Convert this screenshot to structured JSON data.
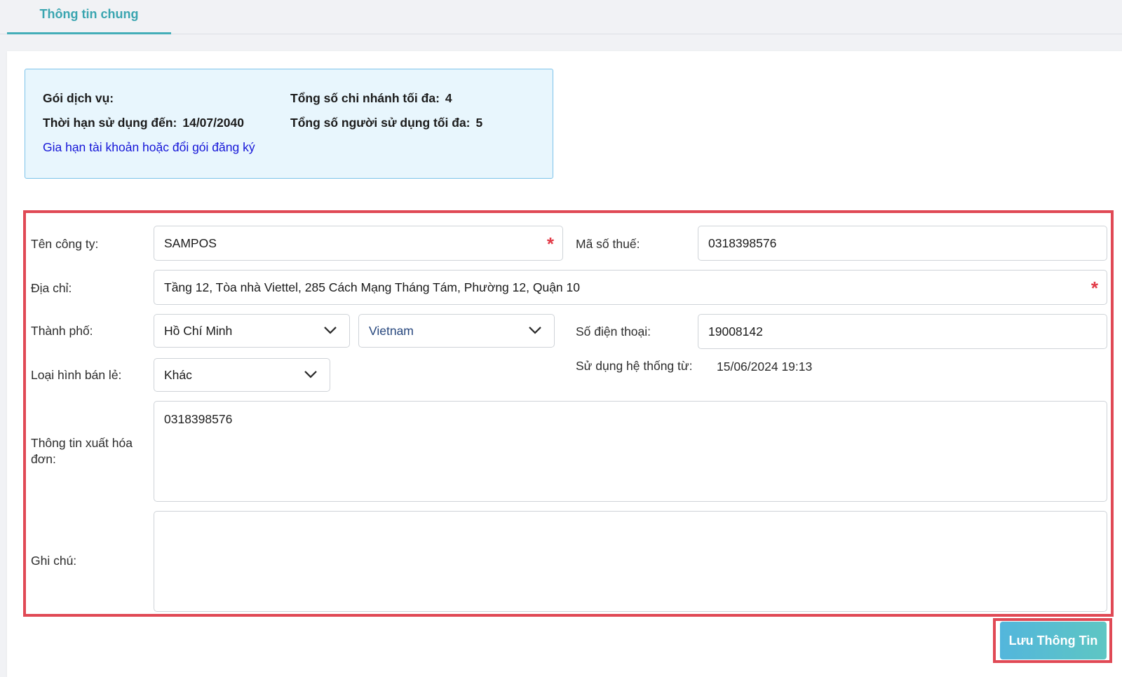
{
  "tabs": [
    {
      "label": "Thông tin chung",
      "active": true
    }
  ],
  "subscription": {
    "package_label": "Gói dịch vụ:",
    "package_value": "",
    "expiry_label": "Thời hạn sử dụng đến:",
    "expiry_value": "14/07/2040",
    "max_branches_label": "Tổng số chi nhánh tối đa:",
    "max_branches_value": "4",
    "max_users_label": "Tổng số người sử dụng tối đa:",
    "max_users_value": "5",
    "renew_link": "Gia hạn tài khoản hoặc đổi gói đăng ký"
  },
  "form": {
    "company_name": {
      "label": "Tên công ty:",
      "value": "SAMPOS",
      "required": true
    },
    "tax_code": {
      "label": "Mã số thuế:",
      "value": "0318398576"
    },
    "address": {
      "label": "Địa chỉ:",
      "value": "Tầng 12, Tòa nhà Viettel, 285 Cách Mạng Tháng Tám, Phường 12, Quận 10",
      "required": true
    },
    "city": {
      "label": "Thành phố:",
      "value": "Hồ Chí Minh"
    },
    "country": {
      "value": "Vietnam"
    },
    "phone": {
      "label": "Số điện thoại:",
      "value": "19008142"
    },
    "retail_type": {
      "label": "Loại hình bán lẻ:",
      "value": "Khác"
    },
    "since": {
      "label": "Sử dụng hệ thống từ:",
      "value": "15/06/2024 19:13"
    },
    "invoice_info": {
      "label": "Thông tin xuất hóa đơn:",
      "value": "0318398576"
    },
    "notes": {
      "label": "Ghi chú:",
      "value": ""
    }
  },
  "actions": {
    "save_label": "Lưu Thông Tin"
  },
  "colors": {
    "accent": "#44aeb8",
    "required": "#e23b48",
    "highlight_border": "#e04955",
    "link": "#1515d8",
    "info_bg": "#e8f6fd"
  },
  "icons": {
    "required": "asterisk-icon",
    "dropdown": "chevron-down-icon"
  }
}
